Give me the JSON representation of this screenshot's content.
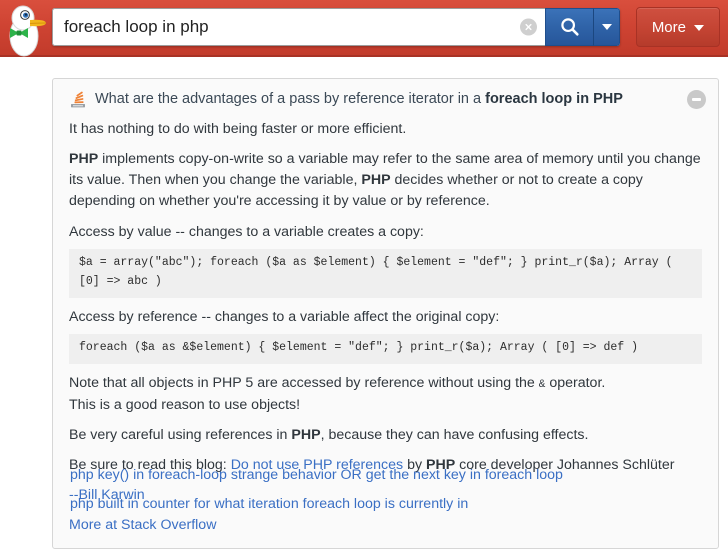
{
  "header": {
    "logo_name": "duckduckgo-duck-logo",
    "search": {
      "value": "foreach loop in php",
      "placeholder": "Search",
      "clear_label": "Clear search",
      "search_label": "Search",
      "dropdown_label": "Search options"
    },
    "more_button": {
      "label": "More",
      "caret": "▾"
    }
  },
  "result_card": {
    "source_icon": "stack-overflow-icon",
    "title_prefix": "What are the advantages of a pass by reference iterator in a ",
    "title_bold": "foreach loop in PHP",
    "collapse_label": "Collapse result",
    "paragraphs": {
      "p1": "It has nothing to do with being faster or more efficient.",
      "p2_a": "PHP",
      "p2_b": " implements copy-on-write so a variable may refer to the same area of memory until you change its value. Then when you change the variable, ",
      "p2_c": "PHP",
      "p2_d": " decides whether or not to create a copy depending on whether you're accessing it by value or by reference.",
      "p3": "Access by value -- changes to a variable creates a copy:",
      "code1": "$a = array(\"abc\"); foreach ($a as $element) { $element = \"def\"; } print_r($a); Array ( [0] => abc )",
      "p4": "Access by reference -- changes to a variable affect the original copy:",
      "code2": "foreach ($a as &$element) { $element = \"def\"; } print_r($a); Array ( [0] => def )",
      "p5_a": "Note that all objects in PHP 5 are accessed by reference without using the ",
      "p5_amp": "&",
      "p5_b": " operator.",
      "p5_c": "This is a good reason to use objects!",
      "p6_a": "Be very careful using references in ",
      "p6_b": "PHP",
      "p6_c": ", because they can have confusing effects.",
      "p7_a": "Be sure to read this blog: ",
      "p7_link": "Do not use PHP references",
      "p7_b": " by ",
      "p7_c": "PHP",
      "p7_d": " core developer Johannes Schlüter"
    },
    "author_link": "--Bill Karwin",
    "more_link": "More at Stack Overflow"
  },
  "related_links": [
    "php key() in foreach-loop strange behavior OR get the next key in foreach loop",
    "php built in counter for what iteration foreach loop is currently in"
  ],
  "colors": {
    "header_red": "#cf4433",
    "search_blue": "#2f63a8",
    "link_blue": "#3a6fc4",
    "code_bg": "#efefef"
  }
}
